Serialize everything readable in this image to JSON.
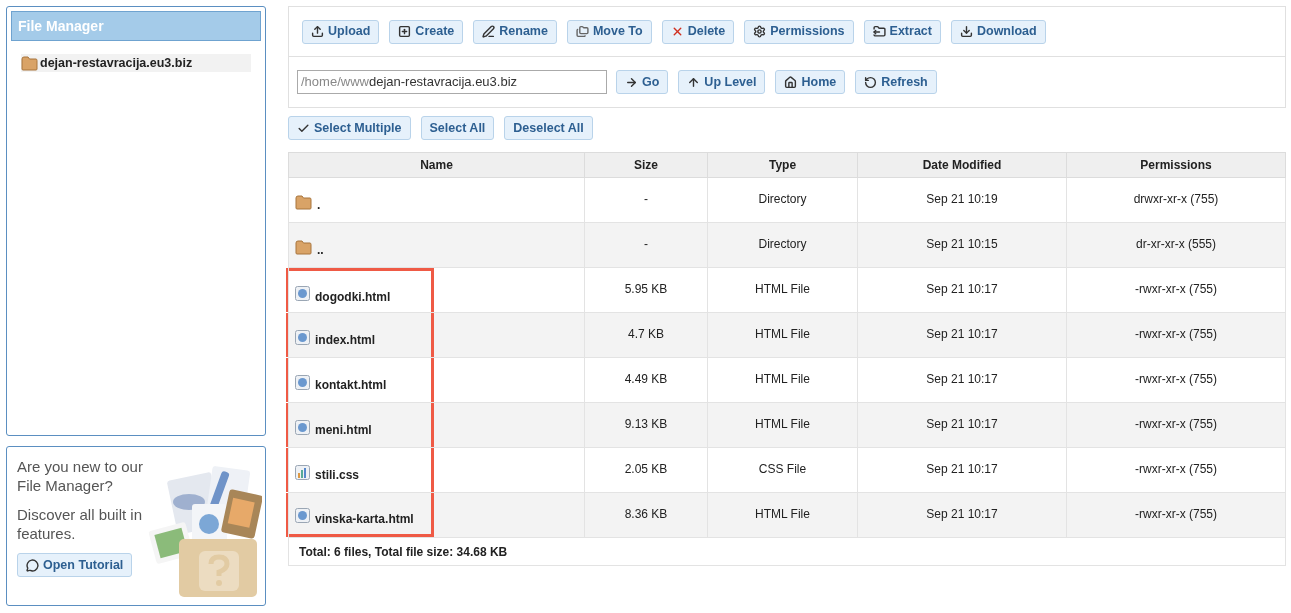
{
  "sidebar": {
    "title": "File Manager",
    "tree": [
      {
        "label": "dejan-restavracija.eu3.biz",
        "selected": true
      }
    ]
  },
  "tutorial": {
    "question": "Are you new to our File Manager?",
    "text": "Discover all built in features.",
    "button": "Open Tutorial"
  },
  "toolbar": [
    {
      "kind": "upload",
      "label": "Upload"
    },
    {
      "kind": "create",
      "label": "Create"
    },
    {
      "kind": "rename",
      "label": "Rename"
    },
    {
      "kind": "move",
      "label": "Move To"
    },
    {
      "kind": "delete",
      "label": "Delete"
    },
    {
      "kind": "permissions",
      "label": "Permissions"
    },
    {
      "kind": "extract",
      "label": "Extract"
    },
    {
      "kind": "download",
      "label": "Download"
    }
  ],
  "path": {
    "prefix": "/home/www",
    "current": "dejan-restavracija.eu3.biz"
  },
  "nav_buttons": [
    {
      "kind": "go",
      "label": "Go"
    },
    {
      "kind": "up",
      "label": "Up Level"
    },
    {
      "kind": "home",
      "label": "Home"
    },
    {
      "kind": "refresh",
      "label": "Refresh"
    }
  ],
  "selection_buttons": [
    {
      "kind": "check",
      "label": "Select Multiple"
    },
    {
      "kind": "plain",
      "label": "Select All"
    },
    {
      "kind": "plain",
      "label": "Deselect All"
    }
  ],
  "table": {
    "columns": [
      "Name",
      "Size",
      "Type",
      "Date Modified",
      "Permissions"
    ],
    "rows": [
      {
        "kind": "folder",
        "name": ".",
        "size": "-",
        "type": "Directory",
        "modified": "Sep 21 10:19",
        "permissions": "drwxr-xr-x (755)",
        "highlighted": false
      },
      {
        "kind": "folder",
        "name": "..",
        "size": "-",
        "type": "Directory",
        "modified": "Sep 21 10:15",
        "permissions": "dr-xr-xr-x (555)",
        "highlighted": false
      },
      {
        "kind": "html",
        "name": "dogodki.html",
        "size": "5.95 KB",
        "type": "HTML File",
        "modified": "Sep 21 10:17",
        "permissions": "-rwxr-xr-x (755)",
        "highlighted": true
      },
      {
        "kind": "html",
        "name": "index.html",
        "size": "4.7 KB",
        "type": "HTML File",
        "modified": "Sep 21 10:17",
        "permissions": "-rwxr-xr-x (755)",
        "highlighted": true
      },
      {
        "kind": "html",
        "name": "kontakt.html",
        "size": "4.49 KB",
        "type": "HTML File",
        "modified": "Sep 21 10:17",
        "permissions": "-rwxr-xr-x (755)",
        "highlighted": true
      },
      {
        "kind": "html",
        "name": "meni.html",
        "size": "9.13 KB",
        "type": "HTML File",
        "modified": "Sep 21 10:17",
        "permissions": "-rwxr-xr-x (755)",
        "highlighted": true
      },
      {
        "kind": "css",
        "name": "stili.css",
        "size": "2.05 KB",
        "type": "CSS File",
        "modified": "Sep 21 10:17",
        "permissions": "-rwxr-xr-x (755)",
        "highlighted": true
      },
      {
        "kind": "html",
        "name": "vinska-karta.html",
        "size": "8.36 KB",
        "type": "HTML File",
        "modified": "Sep 21 10:17",
        "permissions": "-rwxr-xr-x (755)",
        "highlighted": true
      }
    ],
    "footer": "Total: 6 files, Total file size: 34.68 KB"
  }
}
